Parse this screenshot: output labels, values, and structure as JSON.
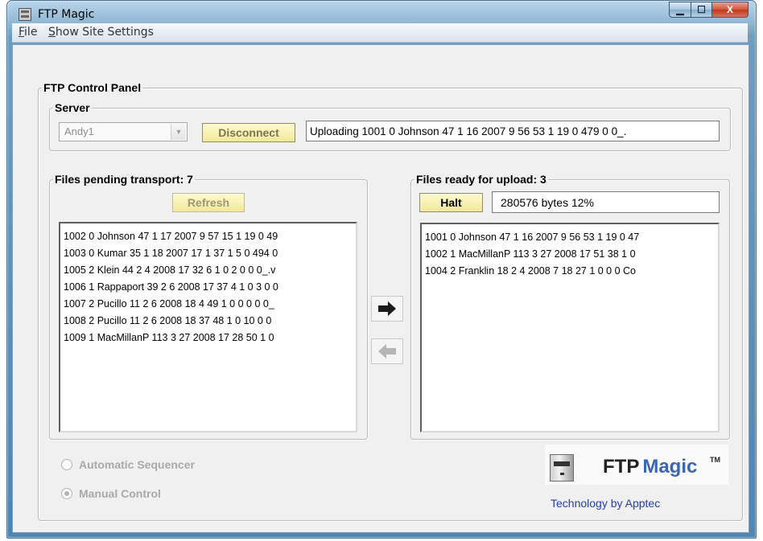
{
  "window": {
    "title": "FTP Magic",
    "controls": {
      "minimize": "▁",
      "maximize": "☐",
      "close": "X"
    }
  },
  "menu": {
    "file": "File",
    "file_mnemonic": "F",
    "file_rest": "ile",
    "site": "Show Site Settings",
    "site_mnemonic": "S",
    "site_rest": "how Site Settings"
  },
  "panel": {
    "title": "FTP Control Panel",
    "server": {
      "title": "Server",
      "selected": "Andy1",
      "disconnect_label": "Disconnect",
      "status": "Uploading 1001 0 Johnson 47 1 16 2007 9 56 53 1 19 0 479 0 0_."
    },
    "pending": {
      "title": "Files pending transport: 7",
      "refresh_label": "Refresh",
      "items": [
        "1002 0 Johnson 47 1 17 2007 9 57 15 1 19 0 49",
        "1003 0 Kumar 35 1 18 2007 17 1 37 1 5 0 494 0",
        "1005 2 Klein 44 2 4 2008 17 32 6 1 0 2 0 0 0_.v",
        "1006 1 Rappaport 39 2 6 2008 17 37 4 1 0 3 0 0",
        "1007 2 Pucillo 11 2 6 2008 18 4 49 1 0 0 0 0 0_",
        "1008 2 Pucillo 11 2 6 2008 18 37 48 1 0 10 0 0",
        "1009 1 MacMillanP 113 3 27 2008 17 28 50 1 0"
      ]
    },
    "ready": {
      "title": "Files ready for upload: 3",
      "halt_label": "Halt",
      "progress": "280576 bytes  12%",
      "items": [
        "1001 0 Johnson 47 1 16 2007 9 56 53 1 19 0 47",
        "1002 1 MacMillanP 113 3 27 2008 17 51 38 1 0",
        "1004 2 Franklin 18 2 4 2008 7 18 27 1 0 0 0 Co"
      ]
    },
    "mode": {
      "automatic": "Automatic Sequencer",
      "manual": "Manual Control"
    }
  },
  "logo": {
    "ftp": "FTP",
    "magic": "Magic",
    "tm": "TM",
    "tagline": "Technology by Apptec"
  },
  "colors": {
    "accent_button": "#f2e79a",
    "logo_magic": "#3b64b7",
    "tagline": "#2840a8"
  }
}
